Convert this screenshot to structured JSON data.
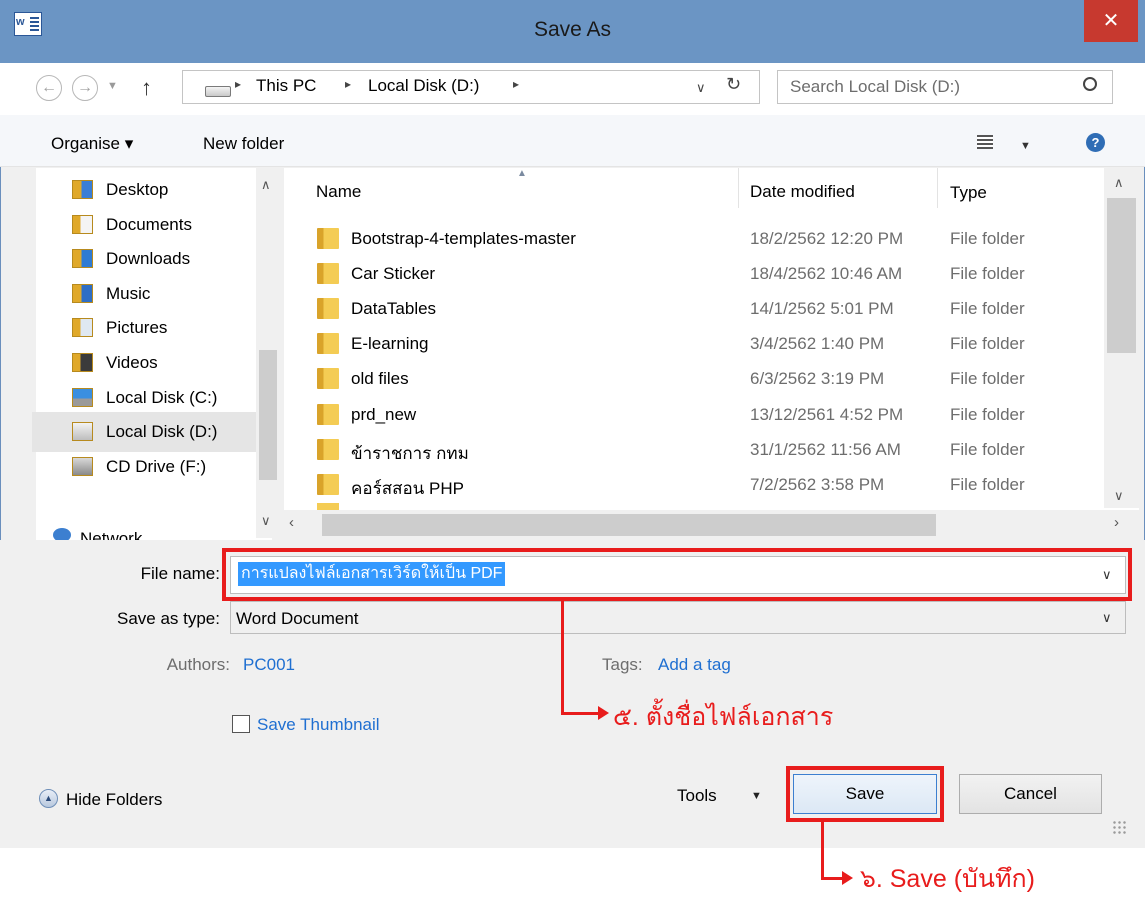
{
  "window": {
    "title": "Save As",
    "close_label": "✕",
    "app_icon_label": "w"
  },
  "address": {
    "segments": [
      "This PC",
      "Local Disk (D:)"
    ],
    "separator": "▸",
    "search_placeholder": "Search Local Disk (D:)"
  },
  "toolbar": {
    "organise_label": "Organise ▾",
    "new_folder_label": "New folder"
  },
  "nav": {
    "items": [
      {
        "label": "Desktop",
        "icon": "desktop-folder-icon"
      },
      {
        "label": "Documents",
        "icon": "documents-icon"
      },
      {
        "label": "Downloads",
        "icon": "downloads-icon"
      },
      {
        "label": "Music",
        "icon": "music-icon"
      },
      {
        "label": "Pictures",
        "icon": "pictures-icon"
      },
      {
        "label": "Videos",
        "icon": "videos-icon"
      },
      {
        "label": "Local Disk (C:)",
        "icon": "windows-drive-icon"
      },
      {
        "label": "Local Disk (D:)",
        "icon": "drive-icon",
        "selected": true
      },
      {
        "label": "CD Drive (F:)",
        "icon": "cd-drive-icon"
      }
    ],
    "network_label": "Network"
  },
  "files": {
    "columns": [
      "Name",
      "Date modified",
      "Type"
    ],
    "rows": [
      {
        "name": "Bootstrap-4-templates-master",
        "date": "18/2/2562 12:20 PM",
        "type": "File folder"
      },
      {
        "name": "Car Sticker",
        "date": "18/4/2562 10:46 AM",
        "type": "File folder"
      },
      {
        "name": "DataTables",
        "date": "14/1/2562 5:01 PM",
        "type": "File folder"
      },
      {
        "name": "E-learning",
        "date": "3/4/2562 1:40 PM",
        "type": "File folder"
      },
      {
        "name": "old files",
        "date": "6/3/2562 3:19 PM",
        "type": "File folder"
      },
      {
        "name": "prd_new",
        "date": "13/12/2561 4:52 PM",
        "type": "File folder"
      },
      {
        "name": "ข้าราชการ กทม",
        "date": "31/1/2562 11:56 AM",
        "type": "File folder"
      },
      {
        "name": "คอร์สสอน PHP",
        "date": "7/2/2562 3:58 PM",
        "type": "File folder"
      }
    ]
  },
  "form": {
    "file_name_label": "File name:",
    "file_name_value": "การแปลงไฟล์เอกสารเวิร์ดให้เป็น PDF",
    "save_type_label": "Save as type:",
    "save_type_value": "Word Document",
    "authors_label": "Authors:",
    "authors_value": "PC001",
    "tags_label": "Tags:",
    "tags_value": "Add a tag",
    "save_thumbnail_label": "Save Thumbnail"
  },
  "footer": {
    "hide_folders_label": "Hide Folders",
    "tools_label": "Tools",
    "save_label": "Save",
    "cancel_label": "Cancel"
  },
  "annotations": {
    "step5": "๕. ตั้งชื่อไฟล์เอกสาร",
    "step6": "๖. Save (บันทึก)",
    "color": "#e81c1c"
  }
}
